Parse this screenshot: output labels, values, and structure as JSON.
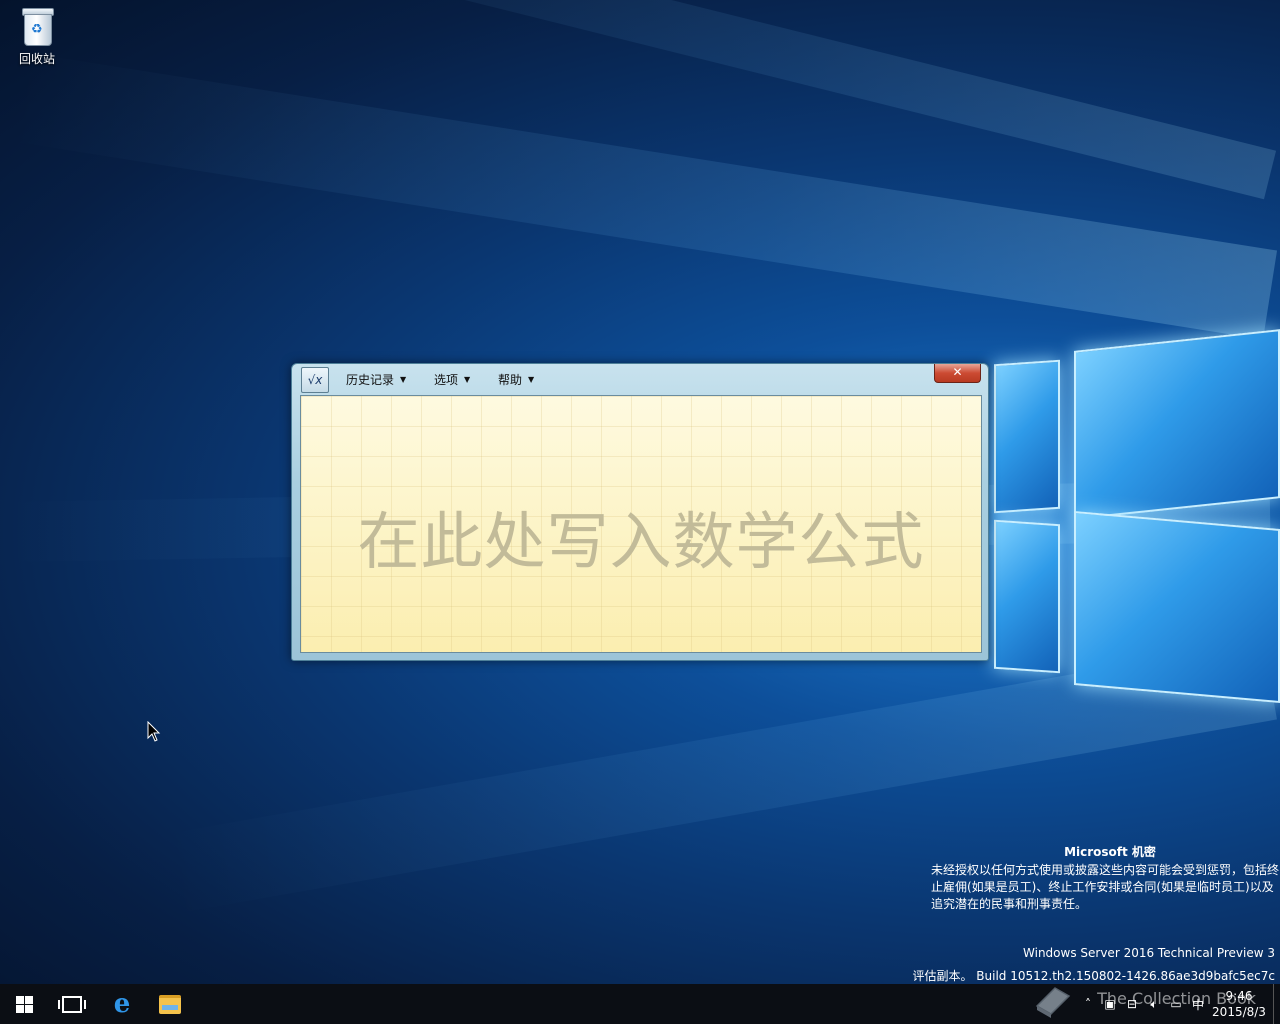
{
  "desktop": {
    "icons": [
      {
        "label": "回收站"
      }
    ]
  },
  "math_panel": {
    "menus": [
      {
        "label": "历史记录"
      },
      {
        "label": "选项"
      },
      {
        "label": "帮助"
      }
    ],
    "close_label": "✕",
    "placeholder": "在此处写入数学公式"
  },
  "notice": {
    "title": "Microsoft 机密",
    "body": "未经授权以任何方式使用或披露这些内容可能会受到惩罚，包括终止雇佣(如果是员工)、终止工作安排或合同(如果是临时员工)以及追究潜在的民事和刑事责任。",
    "edition": "Windows Server 2016 Technical Preview 3",
    "build": "评估副本。 Build 10512.th2.150802-1426.86ae3d9bafc5ec7c"
  },
  "taskbar": {
    "ime": "中",
    "time": "9:46",
    "date": "2015/8/3",
    "watermark": "The Collection Book"
  },
  "colors": {
    "taskbar": "#0b0e14",
    "canvas": "#fdf3c4",
    "accent": "#2f95e8"
  }
}
